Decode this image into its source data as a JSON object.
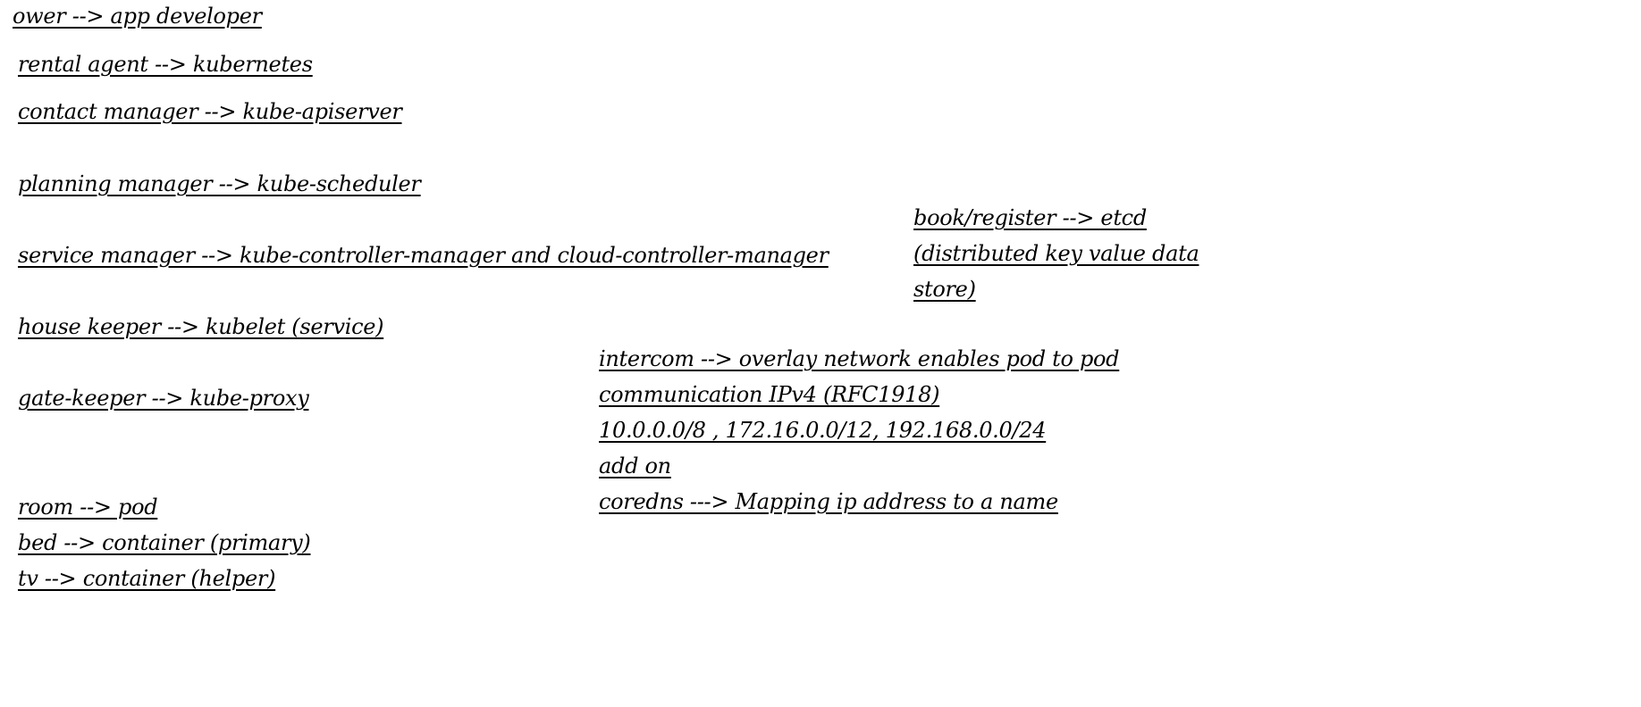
{
  "left_column": [
    "ower --> app developer",
    "rental agent --> kubernetes",
    "contact manager --> kube-apiserver",
    "planning manager --> kube-scheduler",
    "service manager --> kube-controller-manager and cloud-controller-manager",
    "house keeper --> kubelet (service)",
    "gate-keeper --> kube-proxy",
    "room --> pod",
    "bed --> container (primary)",
    "tv --> container (helper)"
  ],
  "etcd_block": [
    "book/register --> etcd",
    "(distributed key value data",
    "store)"
  ],
  "network_block": [
    "intercom --> overlay network enables pod to pod",
    "communication IPv4 (RFC1918)",
    "10.0.0.0/8  , 172.16.0.0/12,  192.168.0.0/24",
    "add on",
    "coredns ---> Mapping ip address to a name"
  ]
}
